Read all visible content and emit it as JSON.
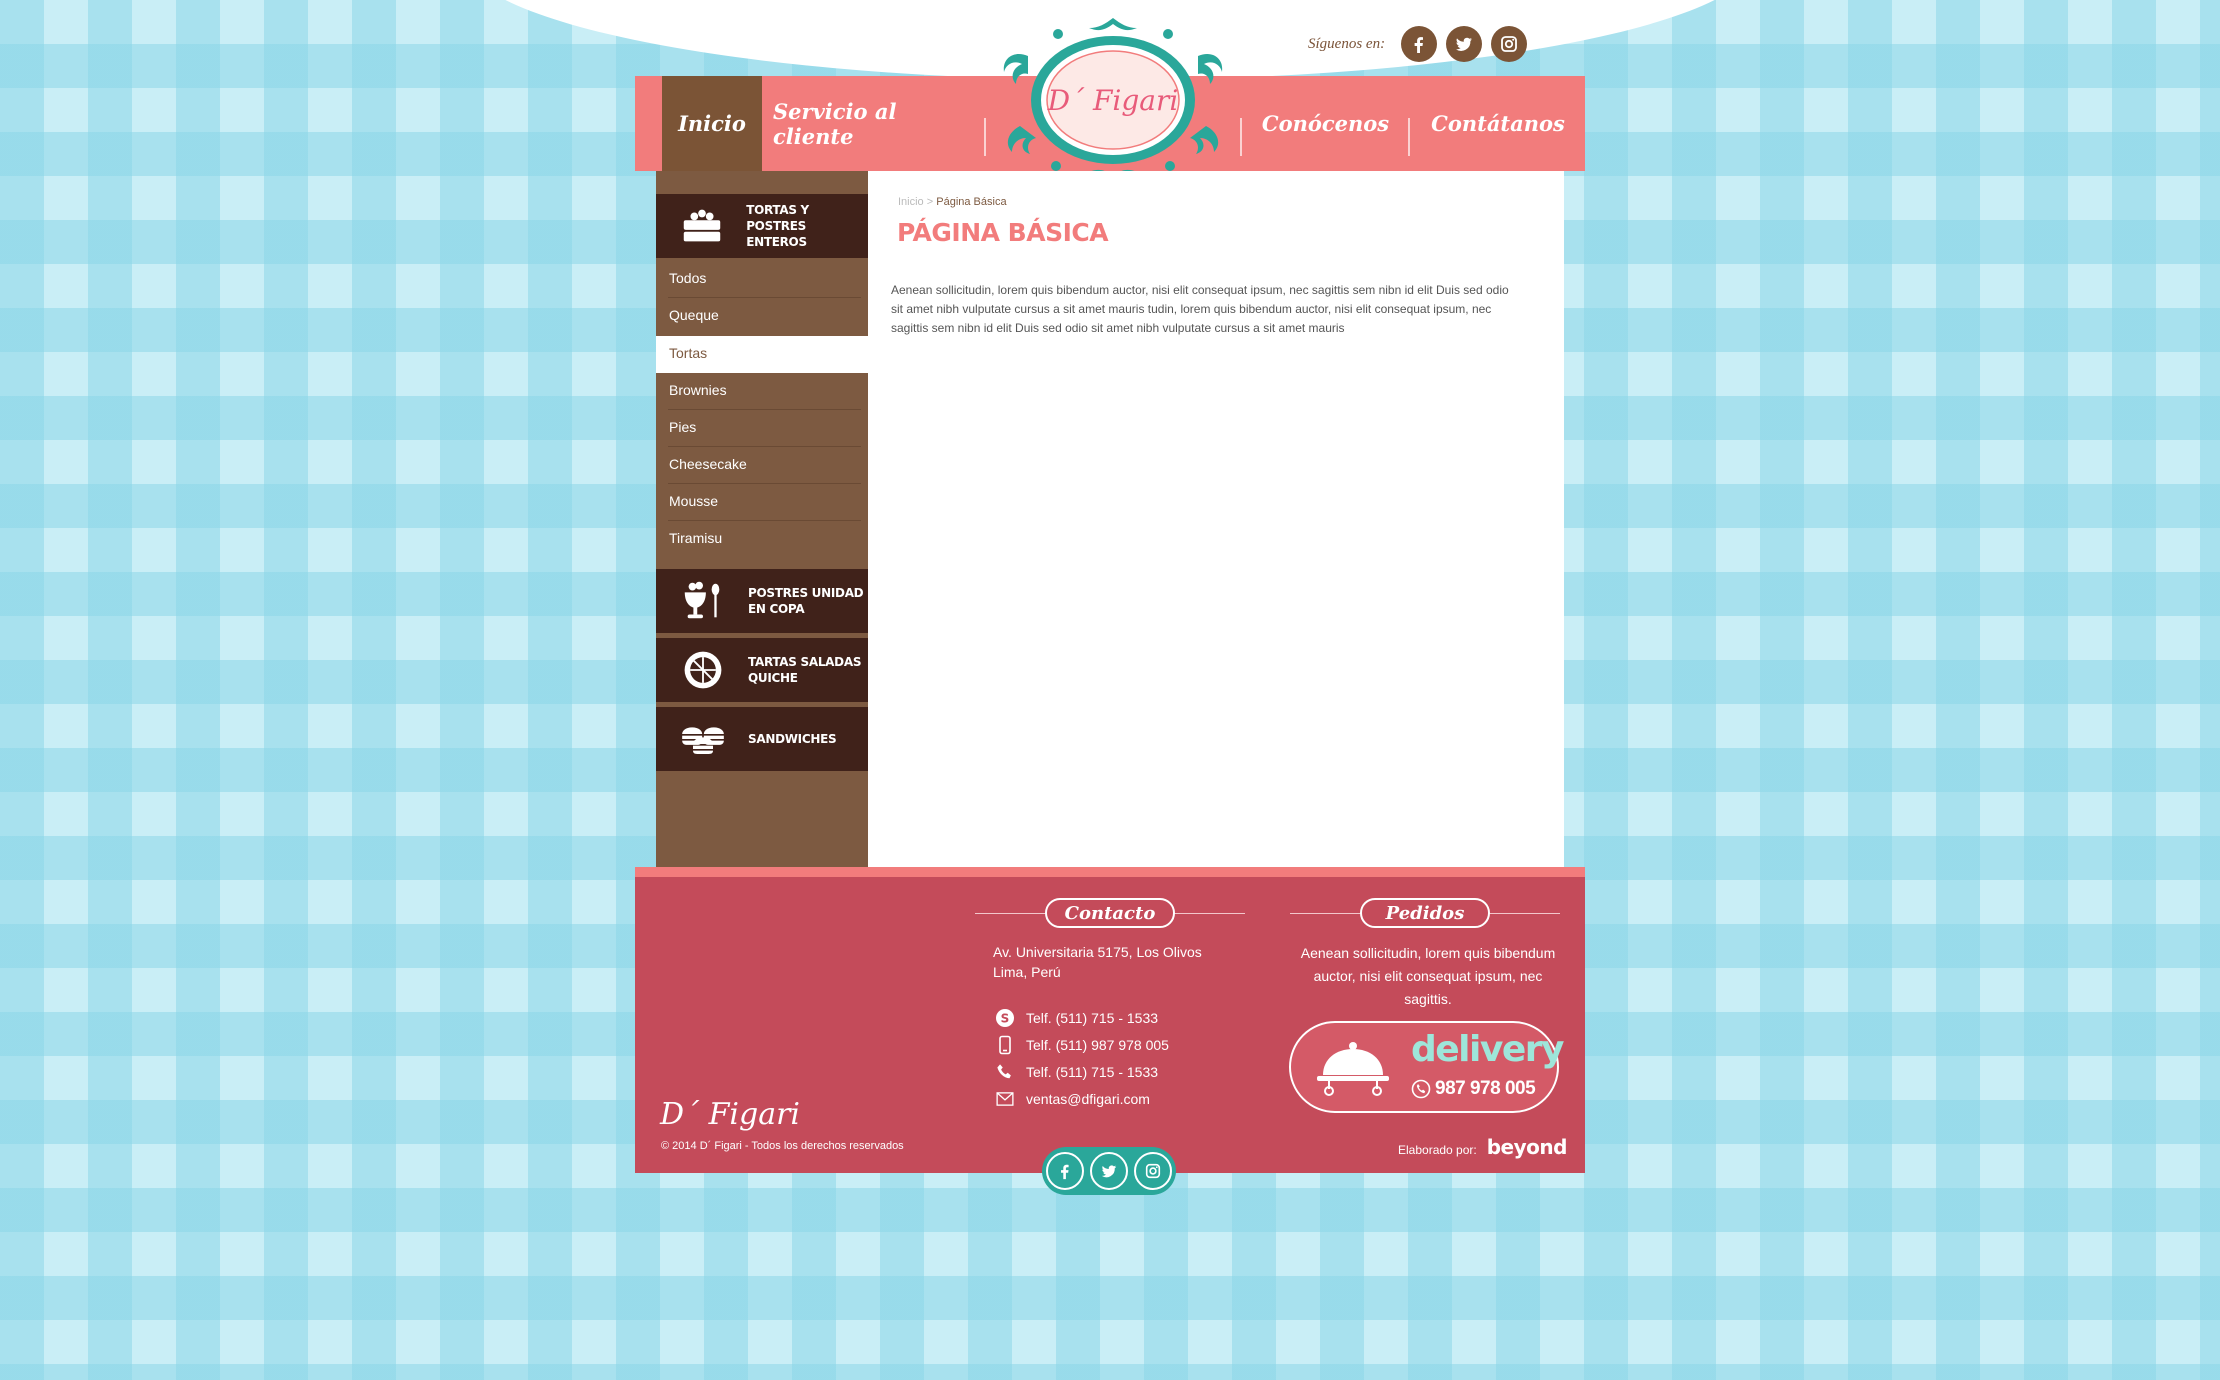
{
  "brand": {
    "logo_text": "D´ Figari"
  },
  "social": {
    "label": "Síguenos en:",
    "icons": [
      "facebook-icon",
      "twitter-icon",
      "instagram-icon"
    ]
  },
  "nav": {
    "items": [
      {
        "label": "Inicio",
        "active": true
      },
      {
        "label": "Servicio al cliente"
      },
      {
        "label": "Conócenos"
      },
      {
        "label": "Contátanos"
      }
    ]
  },
  "sidebar": {
    "categories": [
      {
        "label_line1": "TORTAS Y POSTRES",
        "label_line2": "ENTEROS",
        "icon": "cake-icon"
      },
      {
        "label_line1": "POSTRES UNIDAD",
        "label_line2": "EN COPA",
        "icon": "cup-dessert-icon"
      },
      {
        "label_line1": "TARTAS SALADAS",
        "label_line2": "QUICHE",
        "icon": "tart-icon"
      },
      {
        "label_line1": "SANDWICHES",
        "label_line2": "",
        "icon": "sandwich-icon"
      }
    ],
    "subitems": [
      "Todos",
      "Queque",
      "Tortas",
      "Brownies",
      "Pies",
      "Cheesecake",
      "Mousse",
      "Tiramisu"
    ],
    "active_subitem": "Tortas"
  },
  "breadcrumb": {
    "home": "Inicio",
    "separator": ">",
    "current": "Página Básica"
  },
  "page": {
    "title": "PÁGINA BÁSICA",
    "body": "Aenean sollicitudin, lorem quis bibendum auctor, nisi elit consequat ipsum, nec sagittis sem nibn id elit Duis sed odio sit amet nibh vulputate cursus a sit amet mauris tudin, lorem quis bibendum auctor, nisi elit consequat ipsum, nec sagittis sem nibn id elit Duis sed odio sit amet nibh vulputate cursus a sit amet mauris"
  },
  "footer": {
    "contact_heading": "Contacto",
    "address_line1": "Av. Universitaria 5175, Los Olivos",
    "address_line2": "Lima, Perú",
    "contacts": [
      {
        "icon": "skype-icon",
        "text": "Telf. (511) 715 - 1533"
      },
      {
        "icon": "mobile-phone-icon",
        "text": "Telf. (511) 987 978 005"
      },
      {
        "icon": "phone-icon",
        "text": "Telf. (511) 715 - 1533"
      },
      {
        "icon": "mail-icon",
        "text": "ventas@dfigari.com"
      }
    ],
    "orders_heading": "Pedidos",
    "orders_text": "Aenean sollicitudin, lorem quis bibendum auctor, nisi elit consequat ipsum, nec sagittis.",
    "delivery_word": "delivery",
    "delivery_number": "987 978 005",
    "made_by_label": "Elaborado por:",
    "made_by_brand": "beyond",
    "logo_text": "D´ Figari",
    "copyright": "© 2014 D´ Figari - Todos los derechos reservados"
  },
  "colors": {
    "coral": "#f27c7c",
    "brown": "#7d5a41",
    "dark_brown": "#40221a",
    "footer_red": "#c44b5a",
    "teal": "#2aa79a",
    "mint": "#9ee6da"
  }
}
